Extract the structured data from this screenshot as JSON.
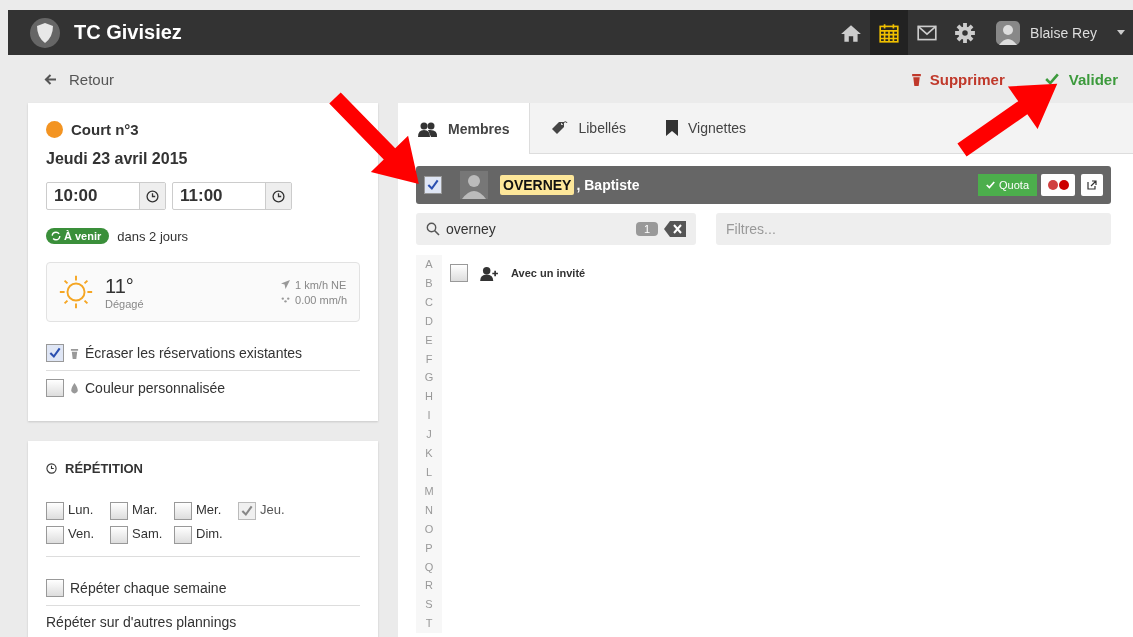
{
  "navbar": {
    "title": "TC Givisiez",
    "user": "Blaise Rey",
    "icons": [
      {
        "kind": "home",
        "selected": false
      },
      {
        "kind": "calendar",
        "selected": true
      },
      {
        "kind": "mail",
        "selected": false
      },
      {
        "kind": "settings",
        "selected": false
      }
    ]
  },
  "actions": {
    "back": "Retour",
    "delete": "Supprimer",
    "validate": "Valider"
  },
  "booking": {
    "court": "Court n°3",
    "date": "Jeudi 23 avril 2015",
    "start_time": "10:00",
    "end_time": "11:00",
    "status_badge": "À venir",
    "status_text": "dans 2 jours",
    "weather": {
      "temperature": "11°",
      "condition": "Dégagé",
      "wind": "1 km/h NE",
      "rain": "0.00 mm/h"
    },
    "options": [
      {
        "kind": "trash",
        "label": "Écraser les réservations existantes",
        "checked": true
      },
      {
        "kind": "drop",
        "label": "Couleur personnalisée",
        "checked": false
      }
    ]
  },
  "repetition": {
    "title": "RÉPÉTITION",
    "days": [
      {
        "label": "Lun.",
        "checked": false,
        "disabled": false
      },
      {
        "label": "Mar.",
        "checked": false,
        "disabled": false
      },
      {
        "label": "Mer.",
        "checked": false,
        "disabled": false
      },
      {
        "label": "Jeu.",
        "checked": true,
        "disabled": true
      },
      {
        "label": "Ven.",
        "checked": false,
        "disabled": false
      },
      {
        "label": "Sam.",
        "checked": false,
        "disabled": false
      },
      {
        "label": "Dim.",
        "checked": false,
        "disabled": false
      }
    ],
    "weekly": {
      "label": "Répéter chaque semaine",
      "checked": false
    },
    "other": "Répéter sur d'autres plannings"
  },
  "tabs": [
    {
      "kind": "members",
      "label": "Membres",
      "selected": true
    },
    {
      "kind": "tag",
      "label": "Libellés",
      "selected": false
    },
    {
      "kind": "bookmark",
      "label": "Vignettes",
      "selected": false
    }
  ],
  "member": {
    "checked": true,
    "name_match": "OVERNEY",
    "name_rest": ", Baptiste",
    "quota": "Quota"
  },
  "search": {
    "value": "overney",
    "count": "1"
  },
  "filter": {
    "placeholder": "Filtres..."
  },
  "alphabet": [
    "A",
    "B",
    "C",
    "D",
    "E",
    "F",
    "G",
    "H",
    "I",
    "J",
    "K",
    "L",
    "M",
    "N",
    "O",
    "P",
    "Q",
    "R",
    "S",
    "T"
  ],
  "guest": {
    "label": "Avec un invité",
    "checked": false
  }
}
